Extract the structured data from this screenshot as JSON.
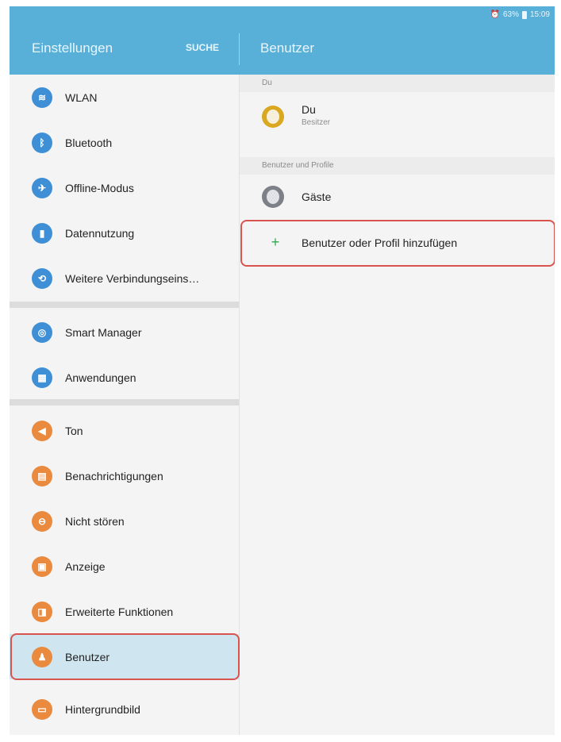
{
  "statusbar": {
    "battery_text": "63%",
    "time": "15:09"
  },
  "appbar": {
    "left_title": "Einstellungen",
    "search_label": "SUCHE",
    "right_title": "Benutzer"
  },
  "sidebar": {
    "items": [
      {
        "label": "WLAN",
        "icon": "wifi-icon",
        "color": "#3f8fd6"
      },
      {
        "label": "Bluetooth",
        "icon": "bluetooth-icon",
        "color": "#3f8fd6"
      },
      {
        "label": "Offline-Modus",
        "icon": "airplane-icon",
        "color": "#3f8fd6"
      },
      {
        "label": "Datennutzung",
        "icon": "data-usage-icon",
        "color": "#3f8fd6"
      },
      {
        "label": "Weitere Verbindungseins…",
        "icon": "connections-icon",
        "color": "#3f8fd6"
      },
      {
        "label": "Smart Manager",
        "icon": "smart-manager-icon",
        "color": "#3f8fd6"
      },
      {
        "label": "Anwendungen",
        "icon": "apps-icon",
        "color": "#3f8fd6"
      },
      {
        "label": "Ton",
        "icon": "sound-icon",
        "color": "#ea8a3e"
      },
      {
        "label": "Benachrichtigungen",
        "icon": "notifications-icon",
        "color": "#ea8a3e"
      },
      {
        "label": "Nicht stören",
        "icon": "do-not-disturb-icon",
        "color": "#ea8a3e"
      },
      {
        "label": "Anzeige",
        "icon": "display-icon",
        "color": "#ea8a3e"
      },
      {
        "label": "Erweiterte Funktionen",
        "icon": "advanced-features-icon",
        "color": "#ea8a3e"
      },
      {
        "label": "Benutzer",
        "icon": "users-icon",
        "color": "#ea8a3e",
        "selected": true
      },
      {
        "label": "Hintergrundbild",
        "icon": "wallpaper-icon",
        "color": "#ea8a3e"
      }
    ]
  },
  "content": {
    "section_you": "Du",
    "you_name": "Du",
    "you_role": "Besitzer",
    "section_users": "Benutzer und Profile",
    "guest_name": "Gäste",
    "add_label": "Benutzer oder Profil hinzufügen"
  },
  "colors": {
    "accent": "#58b0d9",
    "highlight_outline": "#d9534f",
    "selected_bg": "#cfe6f1",
    "add_plus": "#2fa84f"
  }
}
